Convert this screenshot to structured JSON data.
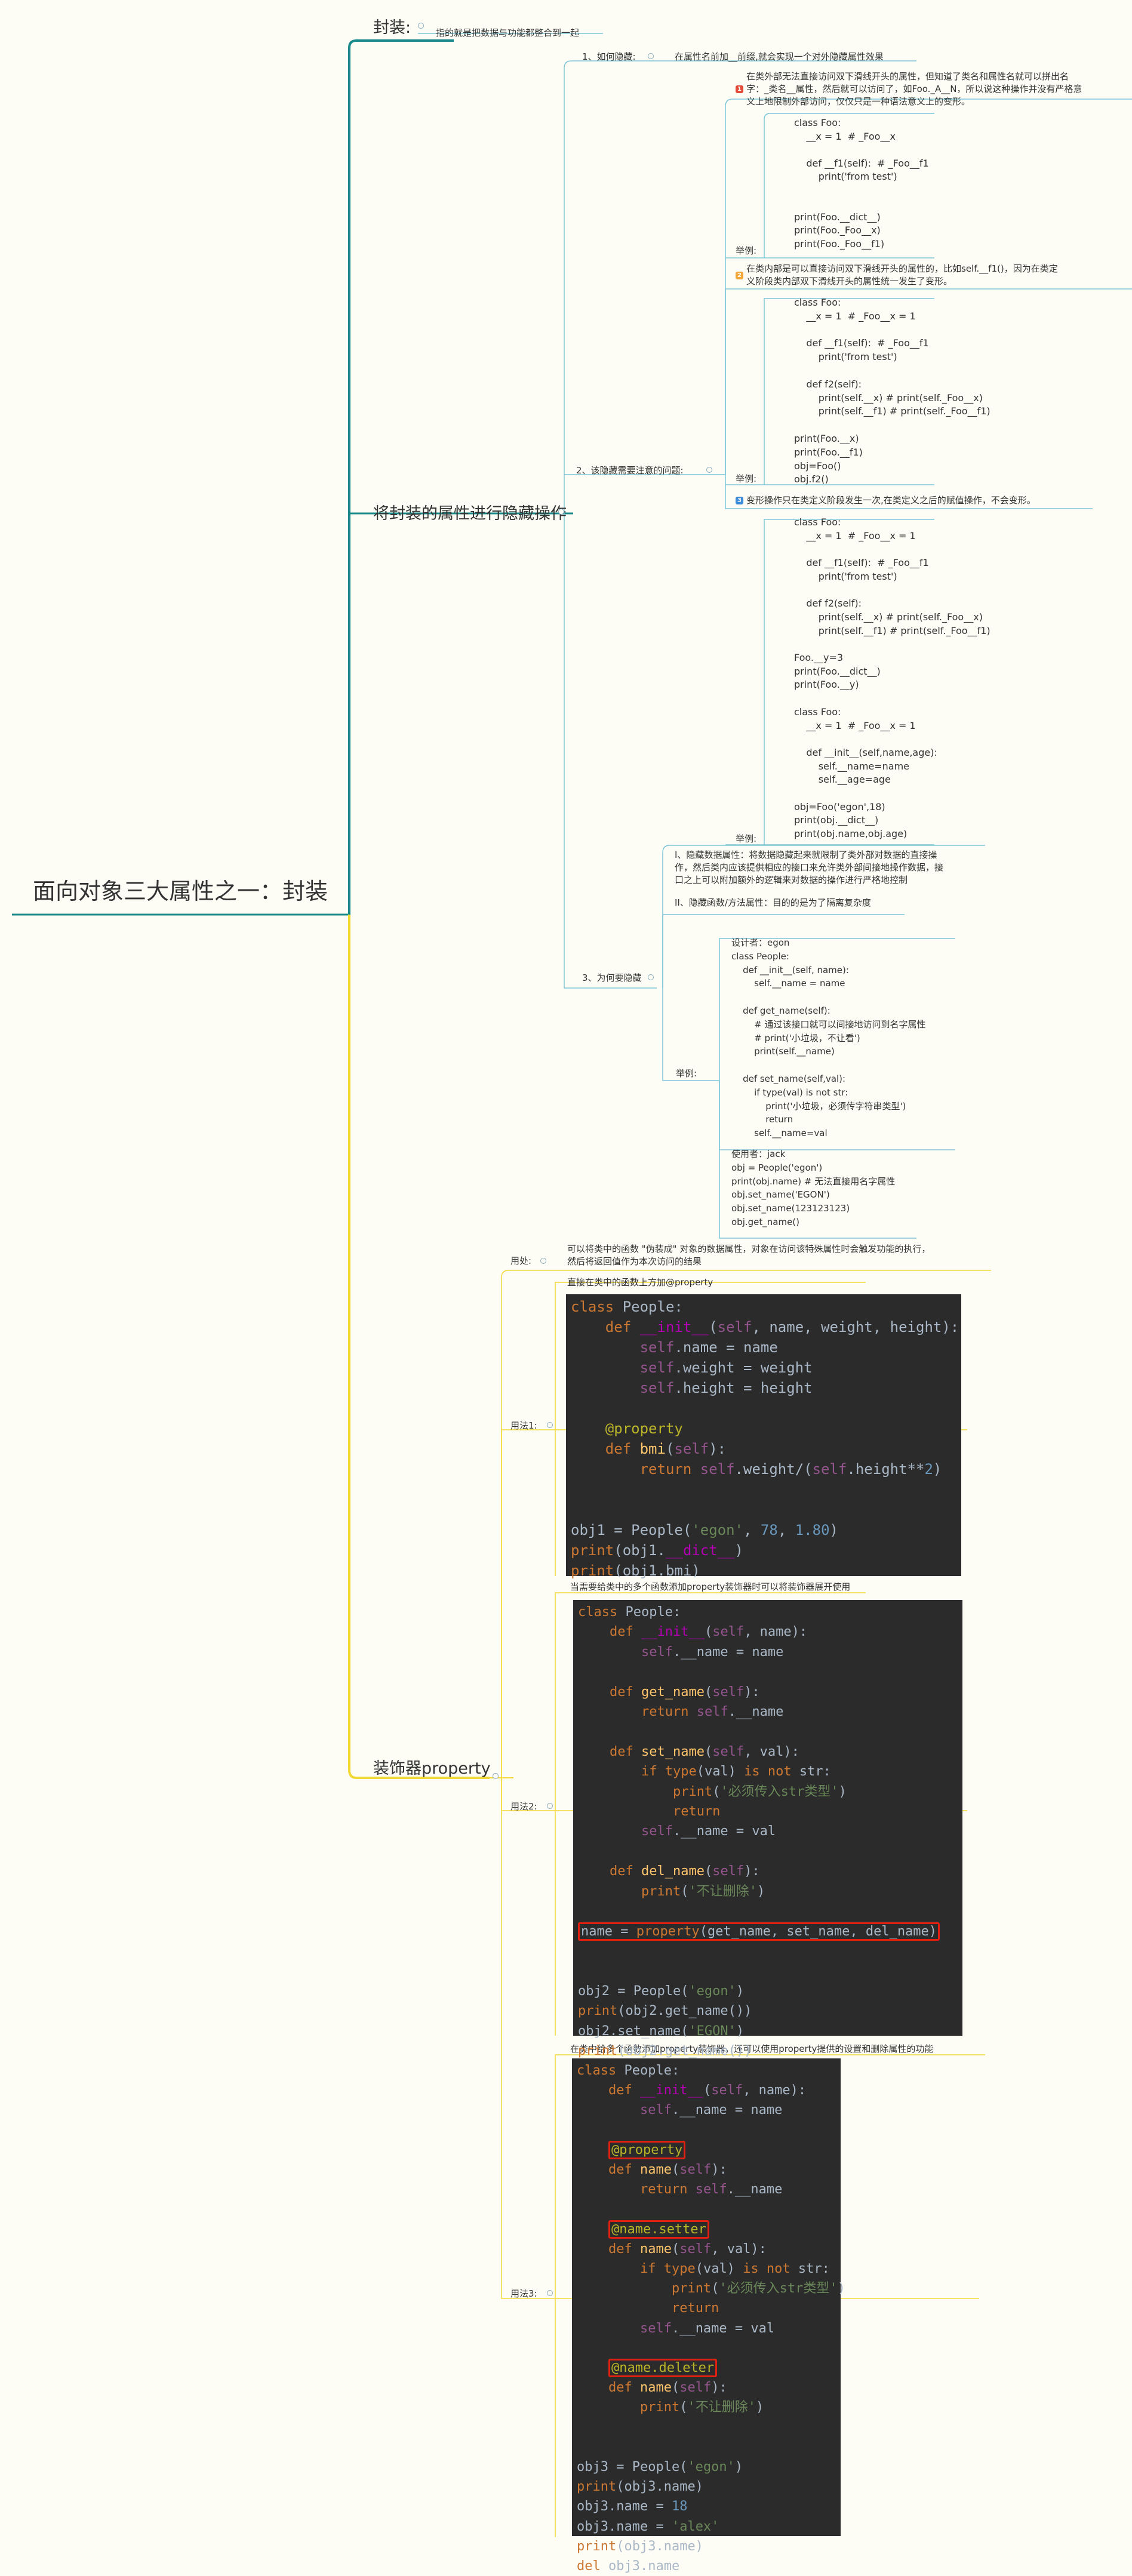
{
  "root": "面向对象三大属性之一：封装",
  "b1": {
    "title": "封装:",
    "desc": "指的就是把数据与功能都整合到一起"
  },
  "b2": {
    "title": "将封装的属性进行隐藏操作",
    "q1": {
      "label": "1、如何隐藏:",
      "text": "在属性名前加__前缀,就会实现一个对外隐藏属性效果"
    },
    "q2": {
      "label": "2、该隐藏需要注意的问题:",
      "n1": "1",
      "note1": "在类外部无法直接访问双下滑线开头的属性，但知道了类名和属性名就可以拼出名\n字：_类名__属性，然后就可以访问了，如Foo._A__N，所以说这种操作并没有严格意\n义上地限制外部访问，仅仅只是一种语法意义上的变形。",
      "ex_label": "举例:",
      "code1": "class Foo:\n    __x = 1  # _Foo__x\n\n    def __f1(self):  # _Foo__f1\n        print('from test')\n\n\nprint(Foo.__dict__)\nprint(Foo._Foo__x)\nprint(Foo._Foo__f1)",
      "n2": "2",
      "note2": "在类内部是可以直接访问双下滑线开头的属性的，比如self.__f1()，因为在类定\n义阶段类内部双下滑线开头的属性统一发生了变形。",
      "code2": "class Foo:\n    __x = 1  # _Foo__x = 1\n\n    def __f1(self):  # _Foo__f1\n        print('from test')\n\n    def f2(self):\n        print(self.__x) # print(self._Foo__x)\n        print(self.__f1) # print(self._Foo__f1)\n\nprint(Foo.__x)\nprint(Foo.__f1)\nobj=Foo()\nobj.f2()",
      "n3": "3",
      "note3": "变形操作只在类定义阶段发生一次,在类定义之后的赋值操作，不会变形。",
      "code3": "class Foo:\n    __x = 1  # _Foo__x = 1\n\n    def __f1(self):  # _Foo__f1\n        print('from test')\n\n    def f2(self):\n        print(self.__x) # print(self._Foo__x)\n        print(self.__f1) # print(self._Foo__f1)\n\nFoo.__y=3\nprint(Foo.__dict__)\nprint(Foo.__y)\n\nclass Foo:\n    __x = 1  # _Foo__x = 1\n\n    def __init__(self,name,age):\n        self.__name=name\n        self.__age=age\n\nobj=Foo('egon',18)\nprint(obj.__dict__)\nprint(obj.name,obj.age)"
    },
    "q3": {
      "label": "3、为何要隐藏",
      "i1": "I、隐藏数据属性：将数据隐藏起来就限制了类外部对数据的直接操\n作，然后类内应该提供相应的接口来允许类外部间接地操作数据，接\n口之上可以附加额外的逻辑来对数据的操作进行严格地控制",
      "i2": "II、隐藏函数/方法属性：目的的是为了隔离复杂度",
      "ex_label": "举例:",
      "designer": "设计者：egon\nclass People:\n    def __init__(self, name):\n        self.__name = name\n\n    def get_name(self):\n        # 通过该接口就可以间接地访问到名字属性\n        # print('小垃圾，不让看')\n        print(self.__name)\n\n    def set_name(self,val):\n        if type(val) is not str:\n            print('小垃圾，必须传字符串类型')\n            return\n        self.__name=val",
      "user": "使用者：jack\nobj = People('egon')\nprint(obj.name) # 无法直接用名字属性\nobj.set_name('EGON')\nobj.set_name(123123123)\nobj.get_name()"
    }
  },
  "b3": {
    "title": "装饰器property",
    "use_label": "用处:",
    "use_text": "可以将类中的函数 \"伪装成\" 对象的数据属性，对象在访问该特殊属性时会触发功能的执行，\n然后将返回值作为本次访问的结果",
    "m1": {
      "label": "用法1:",
      "caption": "直接在类中的函数上方加@property"
    },
    "m2": {
      "label": "用法2:",
      "caption": "当需要给类中的多个函数添加property装饰器时可以将装饰器展开使用"
    },
    "m3": {
      "label": "用法3:",
      "caption": "在类中给多个函数添加property装饰器，还可以使用property提供的设置和删除属性的功能"
    }
  },
  "colors": {
    "accent_teal": "#1a8a8a",
    "accent_yellow": "#f2d935",
    "line": "#7cc6d8"
  }
}
